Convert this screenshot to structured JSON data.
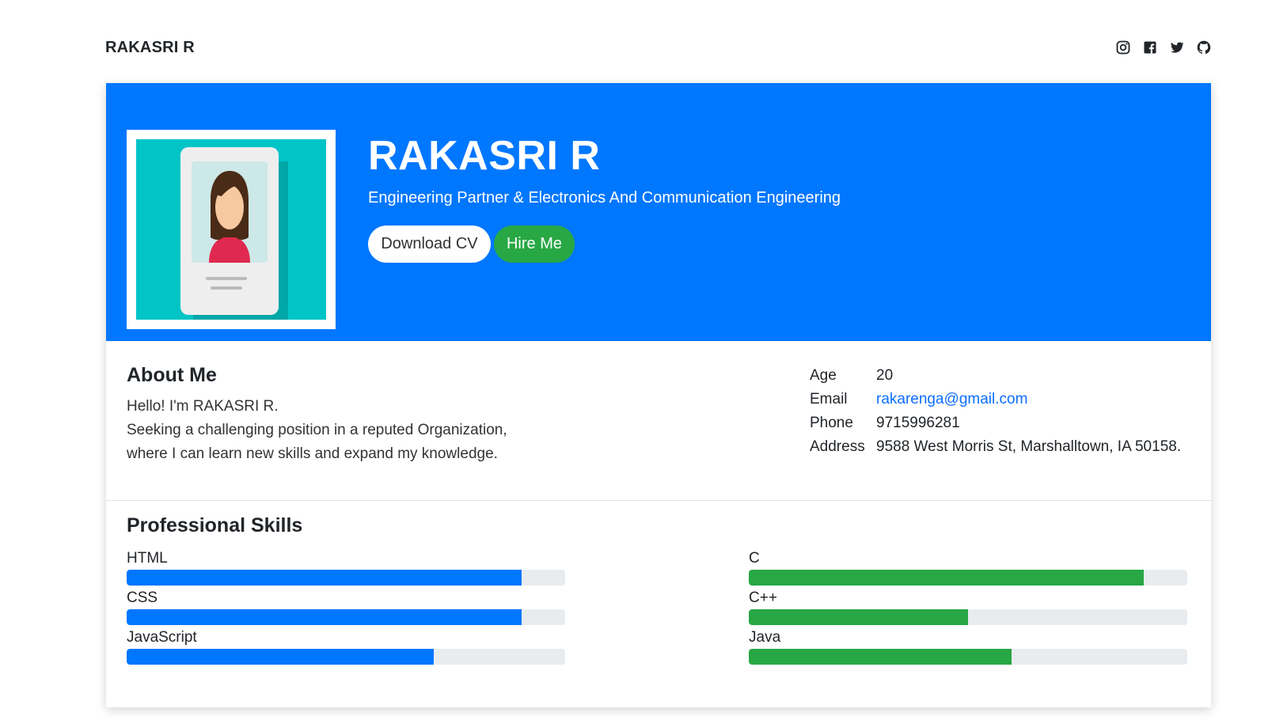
{
  "header": {
    "brand": "RAKASRI R",
    "social_icons": [
      "instagram-icon",
      "facebook-icon",
      "twitter-icon",
      "github-icon"
    ]
  },
  "hero": {
    "name": "RAKASRI R",
    "subtitle": "Engineering Partner & Electronics And Communication Engineering",
    "download_label": "Download CV",
    "hire_label": "Hire Me",
    "background_color": "#0077ff",
    "hire_color": "#28a745"
  },
  "about": {
    "title": "About Me",
    "greeting": "Hello! I'm RAKASRI R.",
    "line1": "Seeking a challenging position in a reputed Organization,",
    "line2": "where I can learn new skills and expand my knowledge."
  },
  "info": {
    "age_label": "Age",
    "age": "20",
    "email_label": "Email",
    "email": "rakarenga@gmail.com",
    "phone_label": "Phone",
    "phone": "9715996281",
    "address_label": "Address",
    "address": "9588 West Morris St, Marshalltown, IA 50158."
  },
  "skills": {
    "title": "Professional Skills",
    "left": [
      {
        "name": "HTML",
        "level": 90
      },
      {
        "name": "CSS",
        "level": 90
      },
      {
        "name": "JavaScript",
        "level": 70
      }
    ],
    "right": [
      {
        "name": "C",
        "level": 90
      },
      {
        "name": "C++",
        "level": 50
      },
      {
        "name": "Java",
        "level": 60
      }
    ],
    "left_color": "#0077ff",
    "right_color": "#28a745"
  }
}
